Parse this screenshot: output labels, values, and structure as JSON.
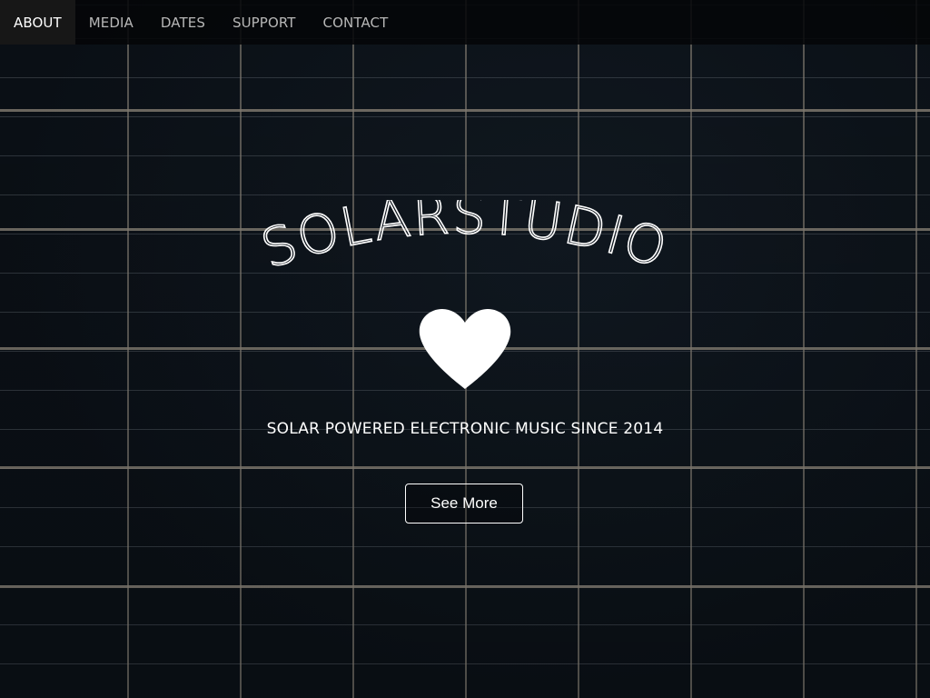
{
  "nav": {
    "items": [
      {
        "label": "ABOUT",
        "active": true
      },
      {
        "label": "MEDIA",
        "active": false
      },
      {
        "label": "DATES",
        "active": false
      },
      {
        "label": "SUPPORT",
        "active": false
      },
      {
        "label": "CONTACT",
        "active": false
      }
    ]
  },
  "hero": {
    "logo_text": "SOLARSTUDIO",
    "icon": "heart-icon",
    "tagline": "SOLAR POWERED ELECTRONIC MUSIC SINCE 2014",
    "cta_label": "See More"
  },
  "colors": {
    "nav_text": "#b7b7b7",
    "nav_active_text": "#ffffff",
    "text": "#ffffff",
    "background": "#0b1016"
  }
}
